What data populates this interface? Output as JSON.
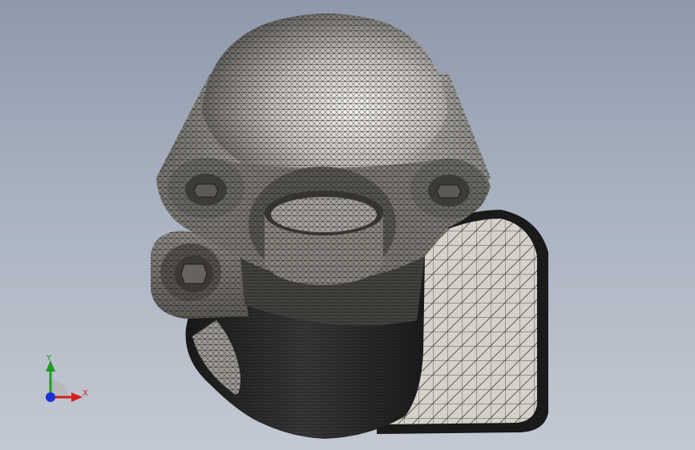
{
  "viewport": {
    "background_top": "#8e99ab",
    "background_bottom": "#c3c9d3"
  },
  "model": {
    "mesh_line_color": "#1e1e1e",
    "surface_color": "#cfcbc3",
    "dark_surface_color": "#2a2a2a"
  },
  "triad": {
    "x_label": "X",
    "y_label": "Y",
    "x_color": "#d32020",
    "y_color": "#1f9a1f",
    "z_color": "#1c2fd6"
  }
}
